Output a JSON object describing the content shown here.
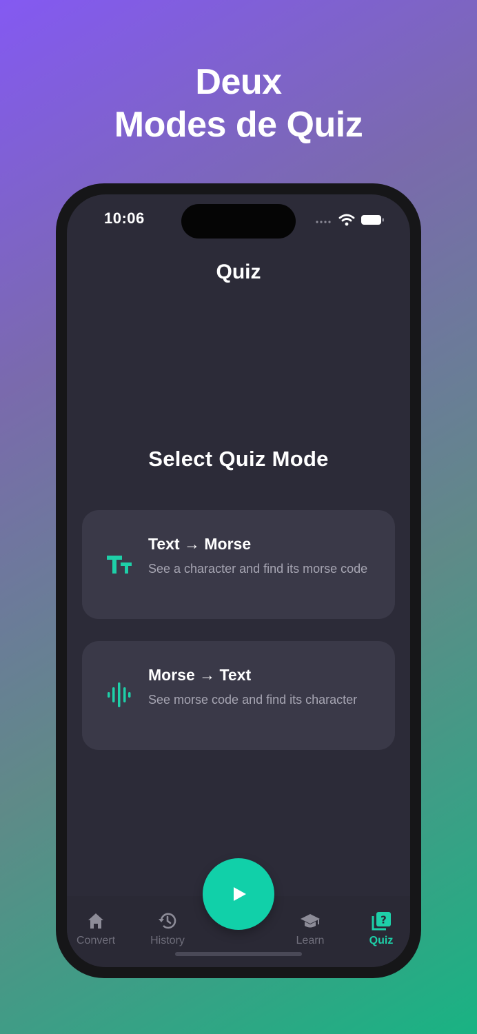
{
  "promo": {
    "line1": "Deux",
    "line2": "Modes de Quiz"
  },
  "status_bar": {
    "time": "10:06",
    "icons": [
      "cellular-icon",
      "wifi-icon",
      "battery-icon"
    ]
  },
  "screen": {
    "title": "Quiz",
    "subtitle": "Select Quiz Mode"
  },
  "modes": [
    {
      "icon": "text-size-icon",
      "title": "Text → Morse",
      "description": "See a character and find its morse code"
    },
    {
      "icon": "waveform-icon",
      "title": "Morse → Text",
      "description": "See morse code and find its character"
    }
  ],
  "fab": {
    "icon": "play-icon"
  },
  "tabs": [
    {
      "label": "Convert",
      "icon": "home-icon",
      "active": false
    },
    {
      "label": "History",
      "icon": "history-icon",
      "active": false
    },
    {
      "label": "Learn",
      "icon": "graduation-cap-icon",
      "active": false
    },
    {
      "label": "Quiz",
      "icon": "quiz-icon",
      "active": true
    }
  ],
  "colors": {
    "accent": "#1ecfa8",
    "screen_bg": "#2c2b38",
    "card_bg": "#3a3948",
    "inactive": "#6f6e7b"
  }
}
